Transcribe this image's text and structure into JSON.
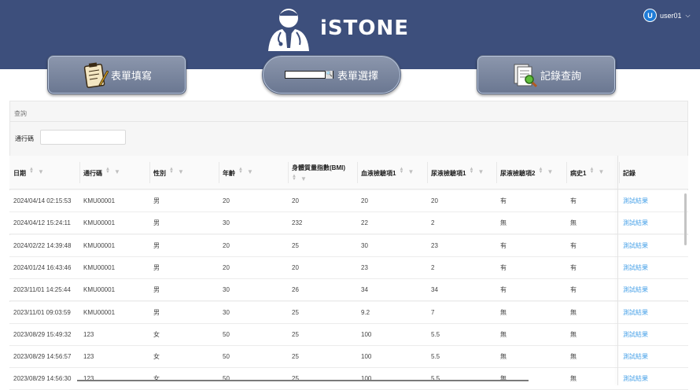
{
  "app": {
    "logo_text": "iSTONE"
  },
  "user": {
    "avatar_letter": "U",
    "name": "user01",
    "caret": "⌵"
  },
  "nav": {
    "form_fill": "表單填寫",
    "form_select": "表單選擇",
    "record_query": "記錄查詢",
    "mini_search_icon": "🔍"
  },
  "panel": {
    "title": "查詢",
    "filter_label": "通行碼",
    "filter_value": ""
  },
  "table": {
    "columns": [
      "日期",
      "通行碼",
      "性別",
      "年齡",
      "身體質量指數(BMI)",
      "血液檢驗項1",
      "尿液檢驗項1",
      "尿液檢驗項2",
      "病史1",
      "記錄"
    ],
    "rows": [
      [
        "2024/04/14 02:15:53",
        "KMU00001",
        "男",
        "20",
        "20",
        "20",
        "20",
        "有",
        "有",
        "測試結果"
      ],
      [
        "2024/04/12 15:24:11",
        "KMU00001",
        "男",
        "30",
        "232",
        "22",
        "2",
        "無",
        "無",
        "測試結果"
      ],
      [
        "2024/02/22 14:39:48",
        "KMU00001",
        "男",
        "20",
        "25",
        "30",
        "23",
        "有",
        "有",
        "測試結果"
      ],
      [
        "2024/01/24 16:43:46",
        "KMU00001",
        "男",
        "20",
        "20",
        "23",
        "2",
        "有",
        "有",
        "測試結果"
      ],
      [
        "2023/11/01 14:25:44",
        "KMU00001",
        "男",
        "30",
        "26",
        "34",
        "34",
        "有",
        "有",
        "測試結果"
      ],
      [
        "2023/11/01 09:03:59",
        "KMU00001",
        "男",
        "30",
        "25",
        "9.2",
        "7",
        "無",
        "無",
        "測試結果"
      ],
      [
        "2023/08/29 15:49:32",
        "123",
        "女",
        "50",
        "25",
        "100",
        "5.5",
        "無",
        "無",
        "測試結果"
      ],
      [
        "2023/08/29 14:56:57",
        "123",
        "女",
        "50",
        "25",
        "100",
        "5.5",
        "無",
        "無",
        "測試結果"
      ],
      [
        "2023/08/29 14:56:30",
        "123",
        "女",
        "50",
        "25",
        "100",
        "5.5",
        "無",
        "無",
        "測試結果"
      ]
    ]
  },
  "colors": {
    "header_bg": "#3d4f7c",
    "link": "#4ba3e8",
    "nav_button": "#7a86a0"
  }
}
